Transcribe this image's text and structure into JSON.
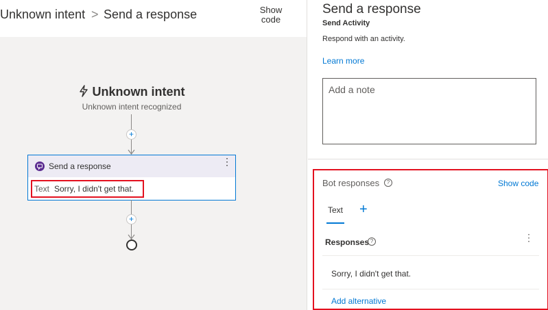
{
  "breadcrumb": {
    "parent": "Unknown intent",
    "separator": ">",
    "current": "Send a response"
  },
  "header": {
    "show_code_label": "Show\ncode"
  },
  "canvas": {
    "trigger": {
      "title": "Unknown intent",
      "subtitle": "Unknown intent recognized",
      "icon": "lightning-icon"
    },
    "add_step_symbol": "+",
    "action_card": {
      "title": "Send a response",
      "icon": "chat-bubble-icon",
      "menu_symbol": "⋮",
      "text_label": "Text",
      "text_value": "Sorry, I didn't get that."
    }
  },
  "properties": {
    "title": "Send a response",
    "subtitle": "Send Activity",
    "description": "Respond with an activity.",
    "learn_more": "Learn more",
    "note_placeholder": "Add a note"
  },
  "bot_responses": {
    "title": "Bot responses",
    "info_symbol": "?",
    "show_code": "Show code",
    "tabs": [
      {
        "label": "Text",
        "selected": true
      }
    ],
    "add_tab_symbol": "+",
    "responses_label": "Responses",
    "menu_symbol": "⋮",
    "items": [
      "Sorry, I didn't get that."
    ],
    "add_alternative": "Add alternative"
  },
  "colors": {
    "accent": "#0078d4",
    "highlight": "#e3101e",
    "card_header": "#edebf4",
    "canvas_bg": "#f3f2f1"
  }
}
